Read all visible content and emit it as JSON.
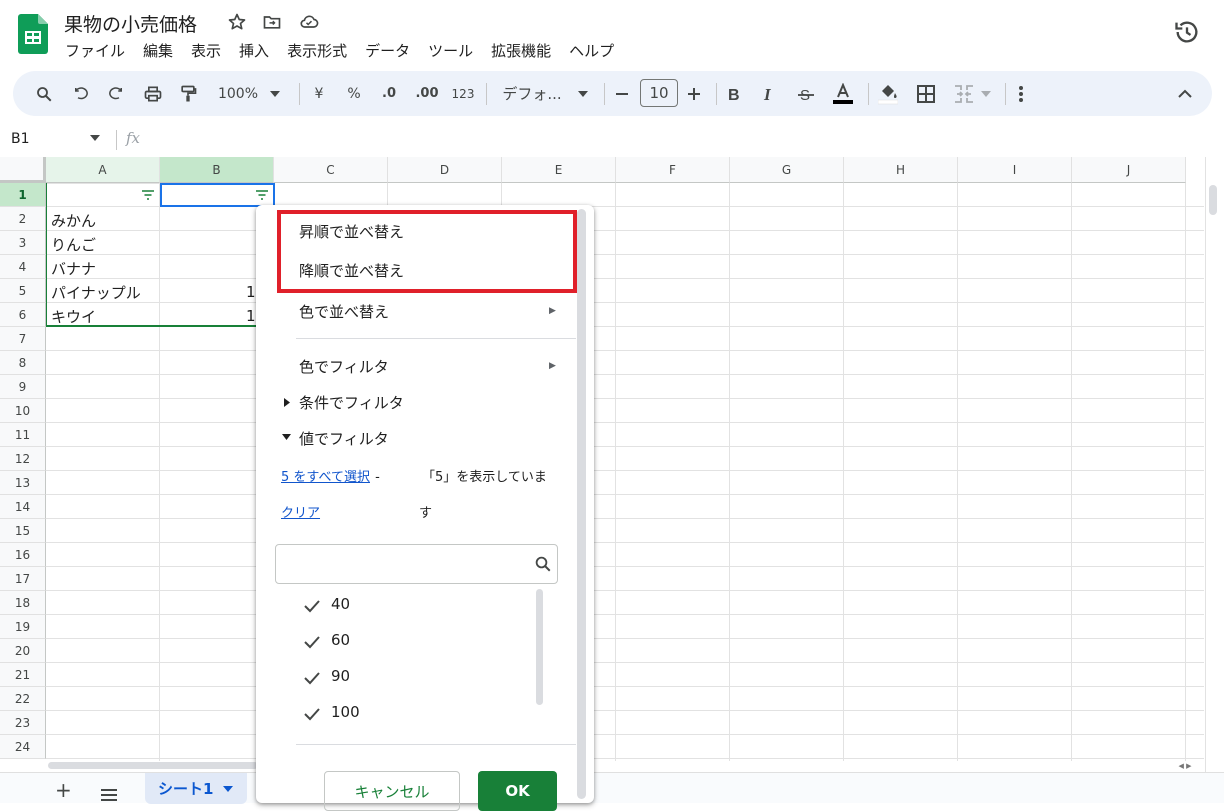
{
  "header": {
    "title": "果物の小売価格",
    "menu": [
      "ファイル",
      "編集",
      "表示",
      "挿入",
      "表示形式",
      "データ",
      "ツール",
      "拡張機能",
      "ヘルプ"
    ]
  },
  "toolbar": {
    "zoom": "100%",
    "currency": "¥",
    "percent": "%",
    "dec_decrease": ".0",
    "dec_increase": ".00",
    "format_123": "123",
    "font": "デフォ...",
    "font_size": "10"
  },
  "formula_bar": {
    "name_box": "B1",
    "fx": "fx"
  },
  "columns": [
    "A",
    "B",
    "C",
    "D",
    "E",
    "F",
    "G",
    "H",
    "I",
    "J"
  ],
  "rows": [
    "1",
    "2",
    "3",
    "4",
    "5",
    "6",
    "7",
    "8",
    "9",
    "10",
    "11",
    "12",
    "13",
    "14",
    "15",
    "16",
    "17",
    "18",
    "19",
    "20",
    "21",
    "22",
    "23",
    "24"
  ],
  "cells": {
    "A2": "みかん",
    "A3": "りんご",
    "A4": "バナナ",
    "A5": "パイナップル",
    "A6": "キウイ",
    "B5": "1",
    "B6": "1"
  },
  "sheet_tab": "シート1",
  "filter_menu": {
    "sort_asc": "昇順で並べ替え",
    "sort_desc": "降順で並べ替え",
    "sort_color": "色で並べ替え",
    "filter_color": "色でフィルタ",
    "filter_condition": "条件でフィルタ",
    "filter_values": "値でフィルタ",
    "select_all": "5 をすべて選択",
    "select_all_dash": "-",
    "clear": "クリア",
    "showing_1": "「5」を表示していま",
    "showing_2": "す",
    "values": [
      "40",
      "60",
      "90",
      "100"
    ],
    "cancel": "キャンセル",
    "ok": "OK"
  },
  "colors": {
    "accent_green": "#188038",
    "highlight_red": "#e0202a",
    "link_blue": "#1155cc",
    "selection_blue": "#1a73e8"
  }
}
